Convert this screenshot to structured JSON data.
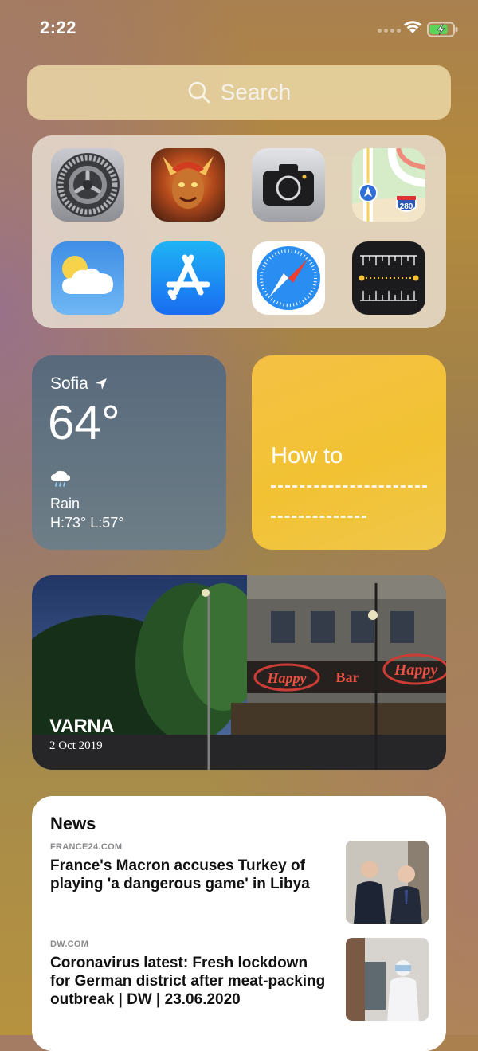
{
  "status": {
    "time": "2:22"
  },
  "search": {
    "label": "Search"
  },
  "apps": [
    "Settings",
    "Game",
    "Camera",
    "Maps",
    "Weather",
    "App Store",
    "Safari",
    "Measure"
  ],
  "maps_icon": {
    "route_shield": "280"
  },
  "weather": {
    "city": "Sofia",
    "temp": "64°",
    "condition": "Rain",
    "hilo": "H:73° L:57°"
  },
  "note": {
    "title": "How to"
  },
  "photo": {
    "place": "VARNA",
    "date": "2 Oct 2019",
    "sign_left": "Happy",
    "sign_mid": "Bar",
    "sign_right": "Happy"
  },
  "news": {
    "title": "News",
    "items": [
      {
        "source": "FRANCE24.COM",
        "headline": "France's Macron accuses Turkey of playing 'a dangerous game' in Libya"
      },
      {
        "source": "DW.COM",
        "headline": "Coronavirus latest: Fresh lockdown for German district after meat-packing outbreak | DW | 23.06.2020"
      }
    ]
  },
  "colors": {
    "note_yellow": "#f2c233",
    "weather_blue": "#5c6d7f",
    "wallpaper_gold": "#b48a3b"
  }
}
